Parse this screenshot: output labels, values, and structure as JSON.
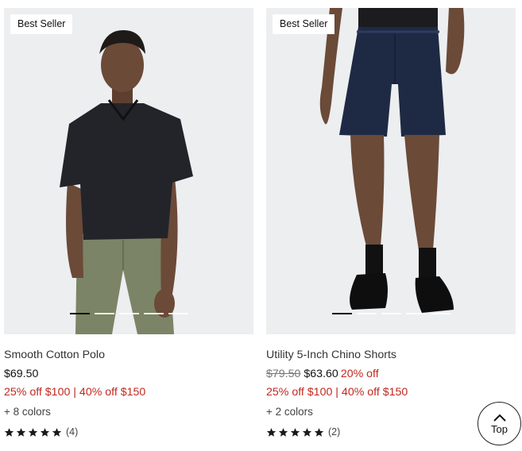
{
  "products": [
    {
      "badge": "Best Seller",
      "name": "Smooth Cotton Polo",
      "price": "$69.50",
      "original_price": "",
      "discount": "",
      "promo": "25% off $100 | 40% off $150",
      "colors": "+ 8 colors",
      "rating_count": "(4)",
      "rating_stars": 5,
      "carousel": {
        "slides": 5,
        "active": 1
      }
    },
    {
      "badge": "Best Seller",
      "name": "Utility 5-Inch Chino Shorts",
      "price": "$63.60",
      "original_price": "$79.50",
      "discount": "20% off",
      "promo": "25% off $100 | 40% off $150",
      "colors": "+ 2 colors",
      "rating_count": "(2)",
      "rating_stars": 5,
      "carousel": {
        "slides": 5,
        "active": 1
      }
    }
  ],
  "back_to_top": {
    "label": "Top",
    "icon": "chevron-up-icon"
  },
  "colors": {
    "sale_red": "#c0271e",
    "image_bg": "#eceef0"
  }
}
